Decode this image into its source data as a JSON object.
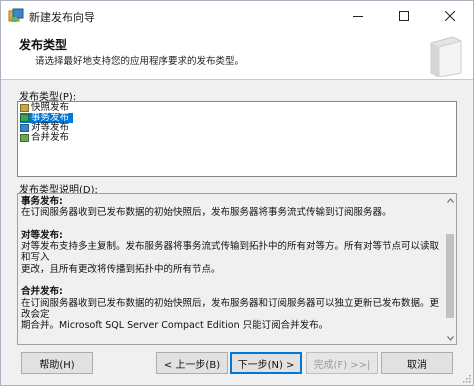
{
  "window": {
    "title": "新建发布向导"
  },
  "header": {
    "title": "发布类型",
    "subtitle": "请选择最好地支持您的应用程序要求的发布类型。"
  },
  "list": {
    "label": "发布类型(P):",
    "items": [
      {
        "label": "快照发布",
        "icon": "snapshot-publication-icon",
        "color": "#c8a64b"
      },
      {
        "label": "事务发布",
        "icon": "transactional-publication-icon",
        "color": "#3aa655"
      },
      {
        "label": "对等发布",
        "icon": "peer-publication-icon",
        "color": "#3a86c8"
      },
      {
        "label": "合并发布",
        "icon": "merge-publication-icon",
        "color": "#6aa84f"
      }
    ],
    "selected": "事务发布"
  },
  "description": {
    "label": "发布类型说明(D):",
    "sections": [
      {
        "heading": "事务发布:",
        "lines": [
          "在订阅服务器收到已发布数据的初始快照后，发布服务器将事务流式传输到订阅服务器。"
        ]
      },
      {
        "heading": "对等发布:",
        "lines": [
          "对等发布支持多主复制。发布服务器将事务流式传输到拓扑中的所有对等方。所有对等节点可以读取和写入",
          "更改，且所有更改将传播到拓扑中的所有节点。"
        ]
      },
      {
        "heading": "合并发布:",
        "lines": [
          "在订阅服务器收到已发布数据的初始快照后，发布服务器和订阅服务器可以独立更新已发布数据。更改会定",
          "期合并。Microsoft SQL Server Compact Edition 只能订阅合并发布。"
        ]
      }
    ]
  },
  "buttons": {
    "help": "帮助(H)",
    "back": "< 上一步(B)",
    "next": "下一步(N) >",
    "finish": "完成(F) >>|",
    "cancel": "取消"
  },
  "colors": {
    "accent": "#0078d7",
    "selection": "#0078d7",
    "window_bg": "#f0f0f0"
  }
}
